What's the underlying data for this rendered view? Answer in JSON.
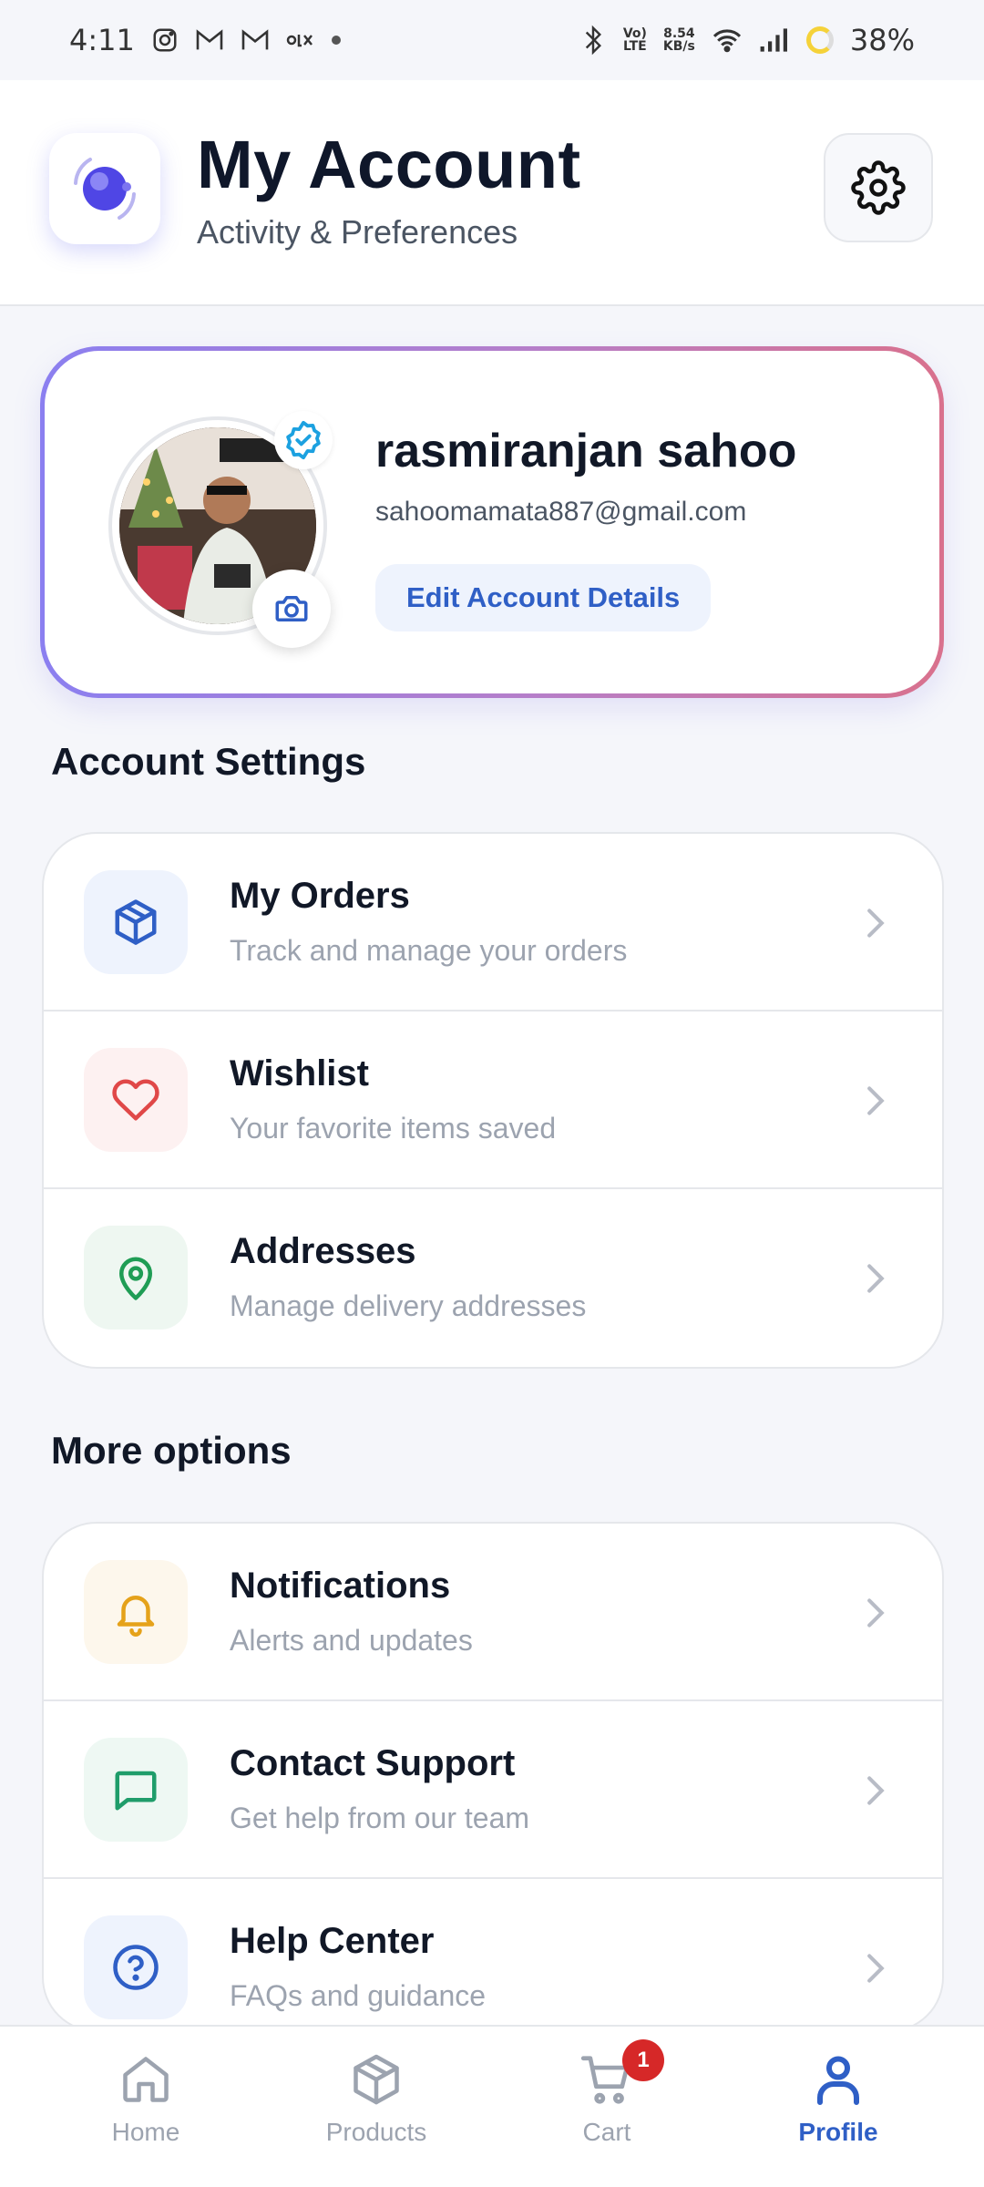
{
  "status_bar": {
    "time": "4:11",
    "speed_value": "8.54",
    "speed_unit": "KB/s",
    "volte_top": "Vo)",
    "volte_bottom": "LTE",
    "battery": "38%"
  },
  "header": {
    "title": "My Account",
    "subtitle": "Activity & Preferences"
  },
  "profile": {
    "name": "rasmiranjan sahoo",
    "email": "sahoomamata887@gmail.com",
    "edit_label": "Edit Account Details"
  },
  "account_settings": {
    "heading": "Account Settings",
    "items": [
      {
        "title": "My Orders",
        "subtitle": "Track and manage your orders",
        "icon": "package-icon",
        "color": "#2f5fc6",
        "bg": "#eef3fd"
      },
      {
        "title": "Wishlist",
        "subtitle": "Your favorite items saved",
        "icon": "heart-icon",
        "color": "#e04848",
        "bg": "#fdf1f1"
      },
      {
        "title": "Addresses",
        "subtitle": "Manage delivery addresses",
        "icon": "map-pin-icon",
        "color": "#1f9d55",
        "bg": "#eef7f1"
      }
    ]
  },
  "more_options": {
    "heading": "More options",
    "items": [
      {
        "title": "Notifications",
        "subtitle": "Alerts and updates",
        "icon": "bell-icon",
        "color": "#e5a21a",
        "bg": "#fdf7ec"
      },
      {
        "title": "Contact Support",
        "subtitle": "Get help from our team",
        "icon": "message-icon",
        "color": "#1f9d6a",
        "bg": "#eef8f3"
      },
      {
        "title": "Help Center",
        "subtitle": "FAQs and guidance",
        "icon": "help-circle-icon",
        "color": "#2f5fc6",
        "bg": "#eef3fd"
      }
    ]
  },
  "bottom_nav": {
    "items": [
      {
        "label": "Home",
        "icon": "home-icon",
        "active": false
      },
      {
        "label": "Products",
        "icon": "package-icon",
        "active": false
      },
      {
        "label": "Cart",
        "icon": "cart-icon",
        "active": false,
        "badge": "1"
      },
      {
        "label": "Profile",
        "icon": "user-icon",
        "active": true
      }
    ]
  },
  "colors": {
    "accent": "#2f5fc6",
    "badge": "#d62828",
    "gradient_start": "#8b7ff0",
    "gradient_end": "#d9718d"
  }
}
